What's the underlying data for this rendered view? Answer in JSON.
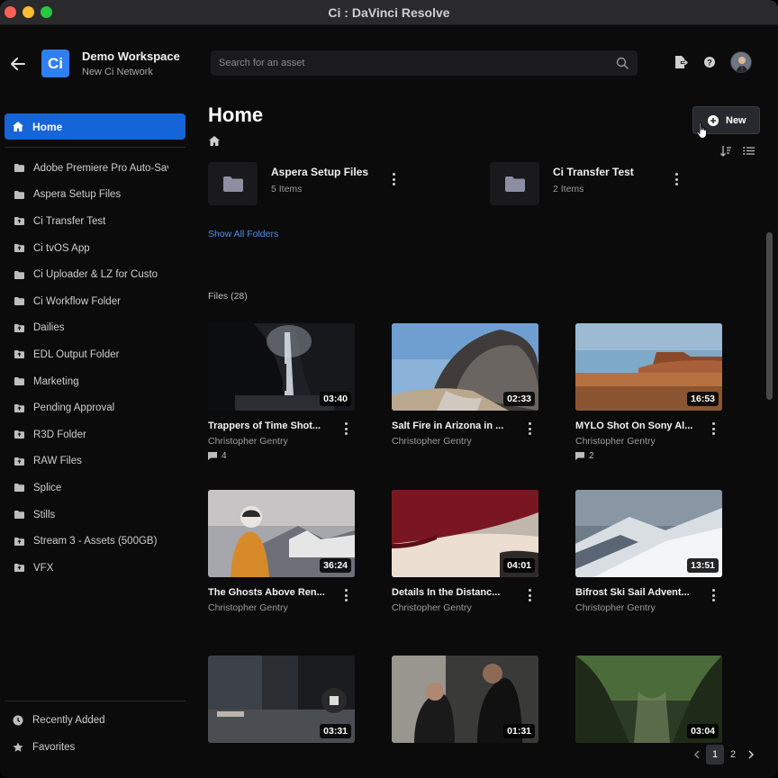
{
  "window": {
    "title": "Ci : DaVinci Resolve"
  },
  "workspace": {
    "logo_text": "Ci",
    "name": "Demo Workspace",
    "network": "New Ci Network"
  },
  "sidebar": {
    "home_label": "Home",
    "folders": [
      {
        "label": "Adobe Premiere Pro Auto-Save",
        "icon": "folder-icon"
      },
      {
        "label": "Aspera Setup Files",
        "icon": "folder-icon"
      },
      {
        "label": "Ci Transfer Test",
        "icon": "folder-upload-icon"
      },
      {
        "label": "Ci tvOS App",
        "icon": "folder-upload-icon"
      },
      {
        "label": "Ci Uploader & LZ for Custo",
        "icon": "folder-icon"
      },
      {
        "label": "Ci Workflow Folder",
        "icon": "folder-icon"
      },
      {
        "label": "Dailies",
        "icon": "folder-upload-icon"
      },
      {
        "label": "EDL Output Folder",
        "icon": "folder-upload-icon"
      },
      {
        "label": "Marketing",
        "icon": "folder-icon"
      },
      {
        "label": "Pending Approval",
        "icon": "folder-upload-icon"
      },
      {
        "label": "R3D Folder",
        "icon": "folder-upload-icon"
      },
      {
        "label": "RAW Files",
        "icon": "folder-upload-icon"
      },
      {
        "label": "Splice",
        "icon": "folder-icon"
      },
      {
        "label": "Stills",
        "icon": "folder-icon"
      },
      {
        "label": "Stream 3 - Assets (500GB)",
        "icon": "folder-upload-icon"
      },
      {
        "label": "VFX",
        "icon": "folder-upload-icon"
      }
    ],
    "recently_added": "Recently Added",
    "favorites": "Favorites"
  },
  "search": {
    "placeholder": "Search for an asset"
  },
  "main": {
    "title": "Home",
    "new_label": "New",
    "folders": [
      {
        "name": "Aspera Setup Files",
        "count": "5 Items"
      },
      {
        "name": "Ci Transfer Test",
        "count": "2 Items"
      }
    ],
    "show_all_folders": "Show All Folders",
    "files_label": "Files (28)",
    "files": [
      {
        "title": "Trappers of Time Shot...",
        "author": "Christopher Gentry",
        "duration": "03:40",
        "comments": "4"
      },
      {
        "title": "Salt Fire in Arizona in ...",
        "author": "Christopher Gentry",
        "duration": "02:33",
        "comments": ""
      },
      {
        "title": "MYLO Shot On Sony Al...",
        "author": "Christopher Gentry",
        "duration": "16:53",
        "comments": "2"
      },
      {
        "title": "The Ghosts Above Ren...",
        "author": "Christopher Gentry",
        "duration": "36:24",
        "comments": ""
      },
      {
        "title": "Details In the Distanc...",
        "author": "Christopher Gentry",
        "duration": "04:01",
        "comments": ""
      },
      {
        "title": "Bifrost Ski Sail Advent...",
        "author": "Christopher Gentry",
        "duration": "13:51",
        "comments": ""
      },
      {
        "title": "",
        "author": "",
        "duration": "03:31",
        "comments": ""
      },
      {
        "title": "",
        "author": "",
        "duration": "01:31",
        "comments": ""
      },
      {
        "title": "",
        "author": "",
        "duration": "03:04",
        "comments": ""
      }
    ]
  },
  "pagination": {
    "pages": [
      "1",
      "2"
    ],
    "current": "1"
  }
}
